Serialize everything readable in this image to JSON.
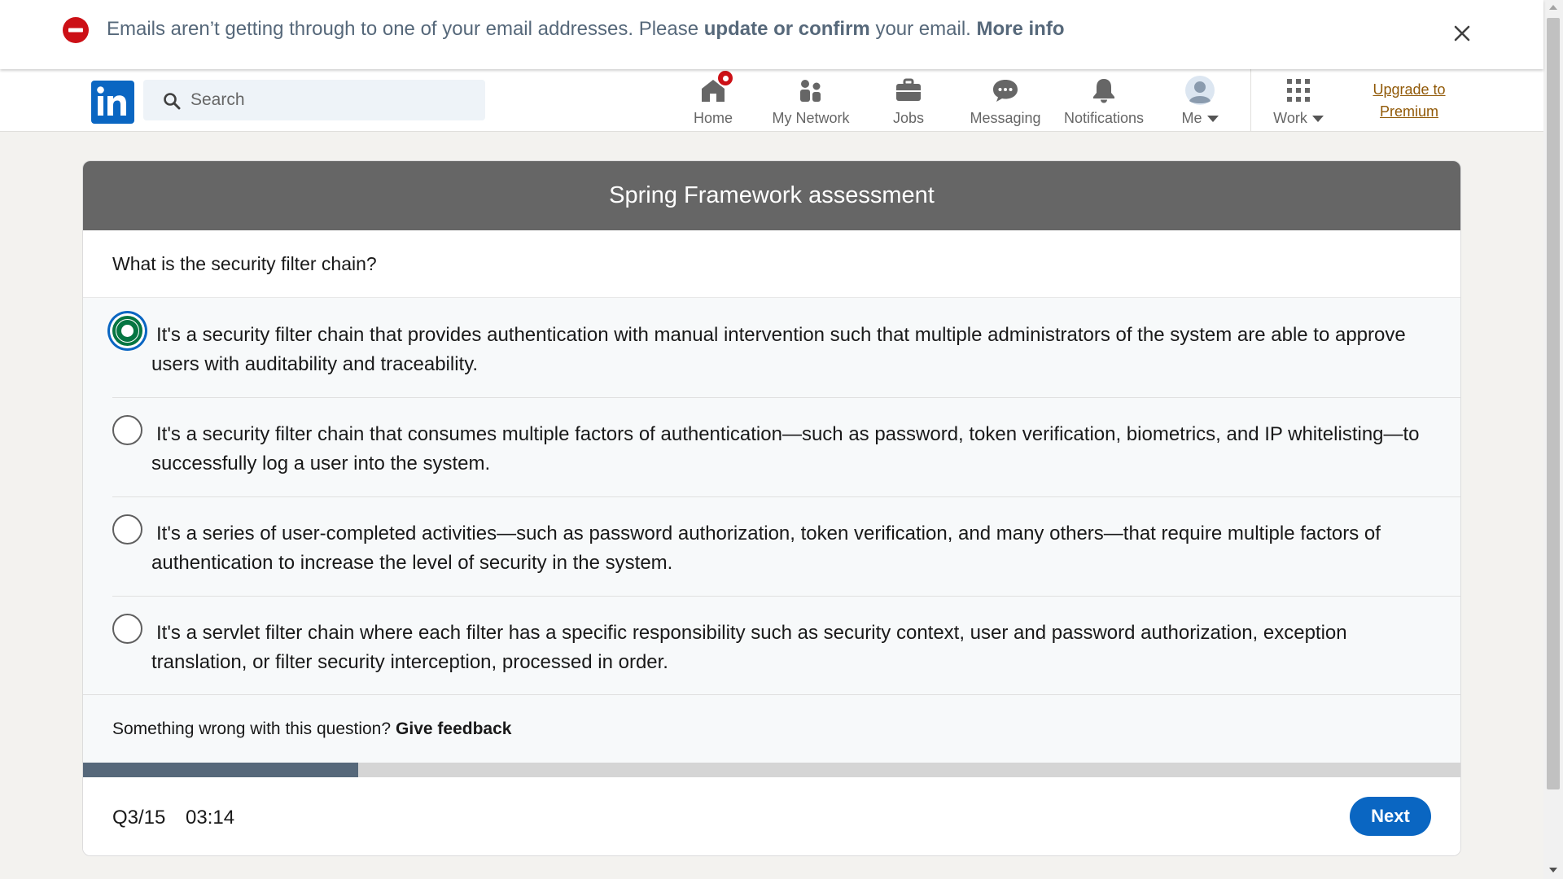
{
  "banner": {
    "text_before": "Emails aren’t getting through to one of your email addresses. Please",
    "action_link": "update or confirm",
    "text_after": "your email.",
    "more_link": "More info",
    "icon": "blocked-stop-icon",
    "close_icon": "close-icon"
  },
  "nav": {
    "logo_text": "in",
    "search_placeholder": "Search",
    "items": [
      {
        "label": "Home",
        "icon": "home-icon",
        "has_badge": true
      },
      {
        "label": "My Network",
        "icon": "people-icon"
      },
      {
        "label": "Jobs",
        "icon": "briefcase-icon"
      },
      {
        "label": "Messaging",
        "icon": "chat-bubble-icon"
      },
      {
        "label": "Notifications",
        "icon": "bell-icon"
      },
      {
        "label": "Me",
        "icon": "avatar-icon",
        "dropdown": true
      },
      {
        "label": "Work",
        "icon": "grid-icon",
        "dropdown": true
      }
    ],
    "premium_line1": "Upgrade to",
    "premium_line2": "Premium"
  },
  "assessment": {
    "title": "Spring Framework assessment",
    "question": "What is the security filter chain?",
    "options": [
      {
        "text": "It's a security filter chain that provides authentication with manual intervention such that multiple administrators of the system are able to approve users with auditability and traceability.",
        "selected": true
      },
      {
        "text": "It's a security filter chain that consumes multiple factors of authentication—such as password, token verification, biometrics, and IP whitelisting—to successfully log a user into the system.",
        "selected": false
      },
      {
        "text": "It's a series of user-completed activities—such as password authorization, token verification, and many others—that require multiple factors of authentication to increase the level of security in the system.",
        "selected": false
      },
      {
        "text": "It's a servlet filter chain where each filter has a specific responsibility such as security context, user and password authorization, exception translation, or filter security interception, processed in order.",
        "selected": false
      }
    ],
    "feedback_prompt": "Something wrong with this question?",
    "feedback_link": "Give feedback",
    "progress_fraction": 0.2,
    "counter": "Q3/15",
    "timer": "03:14",
    "next_label": "Next"
  },
  "colors": {
    "brand_blue": "#0a66c2",
    "selected_green": "#057642",
    "alert_red": "#cc1016",
    "premium_gold": "#915907",
    "header_gray": "#666666",
    "progress_fill": "#56687a"
  }
}
